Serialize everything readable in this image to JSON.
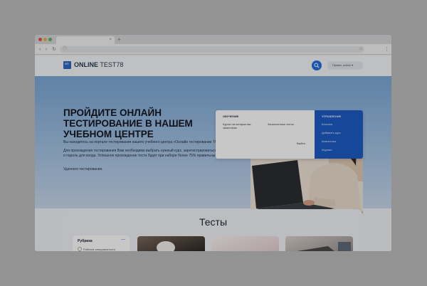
{
  "browser": {
    "tab_close": "×",
    "tab_new": "+",
    "back": "‹",
    "forward": "›",
    "reload": "↻",
    "star": "☆",
    "menu": "⋮",
    "url_icon": "ⓘ"
  },
  "header": {
    "logo_mark": "OT",
    "logo_bold": "ONLINE",
    "logo_light": "TEST78",
    "user_label": "Привет, admin ▾"
  },
  "hero": {
    "title": "ПРОЙДИТЕ ОНЛАЙН ТЕСТИРОВАНИЕ В НАШЕМ УЧЕБНОМ ЦЕНТРЕ",
    "p1": "Вы находитесь на портале тестирования нашего учебного центра «Онлайн тестирование 78»",
    "p2": "Для прохождения тестирования Вам необходимо выбрать нужный курс, зарегистрироваться и ввести логин и пароль для входа. Успешное прохождение теста будет при наборе более 75% правильных ответов",
    "p3": "Удачного тестирования."
  },
  "tests": {
    "title": "Тесты",
    "rubric_title": "Рубрика",
    "rubric_toggle": "—",
    "rubric_item": "Рабочие специальности"
  },
  "dropdown": {
    "learning_heading": "ОБУЧЕНИЕ",
    "learning_link_1": "Курсы на которые вы зачислены",
    "learning_link_2": "Зачисленные тесты",
    "logout": "Выйти",
    "management_heading": "УПРАВЛЕНИЕ",
    "management_items": [
      "Консоль",
      "Добавить курс",
      "Аналитика",
      "Журнал"
    ]
  },
  "colors": {
    "accent": "#1f6fe0",
    "management_panel": "#1d5bc4"
  }
}
